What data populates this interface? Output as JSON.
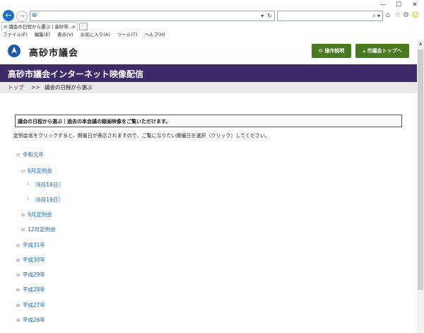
{
  "browser": {
    "window_controls": {
      "minimize": "—",
      "maximize": "☐",
      "close": "✕"
    },
    "tab_label": "議会の日程から選ぶ | 高砂市...",
    "menu": [
      "ファイル(F)",
      "編集(E)",
      "表示(V)",
      "お気に入り(A)",
      "ツール(T)",
      "ヘルプ(H)"
    ],
    "icons": {
      "back": "back-arrow-icon",
      "forward": "forward-arrow-icon",
      "refresh": "refresh-icon",
      "search": "search-icon",
      "home": "home-icon",
      "favorites": "star-icon",
      "settings": "gear-icon",
      "smiley": "smiley-icon"
    }
  },
  "header": {
    "site_name": "高砂市議会",
    "help_button": "操作説明",
    "top_button": "市議会トップへ",
    "brand_color": "#1e5aa8",
    "button_color": "#4a7a1f"
  },
  "banner": {
    "title": "高砂市議会インターネット映像配信",
    "color": "#3d2a6a"
  },
  "breadcrumb": {
    "home": "トップ",
    "separator": ">>",
    "current": "議会の日程から選ぶ"
  },
  "notice": "議会の日程から選ぶ｜過去の本会議の録画映像をご覧いただけます。",
  "intro": "定例会名をクリックすると、開催日が表示されますので、ご覧になりたい開催日を選択（クリック）してください。",
  "tree": {
    "year_2019": "令和元年",
    "session_june": "6月定例会",
    "day_june18": "（6月18日）",
    "day_june19": "（6月19日）",
    "session_sept": "9月定例会",
    "session_dec": "12月定例会",
    "heisei31": "平成31年",
    "heisei30": "平成30年",
    "heisei29": "平成29年",
    "heisei28": "平成28年",
    "heisei27": "平成27年",
    "heisei26": "平成26年"
  }
}
